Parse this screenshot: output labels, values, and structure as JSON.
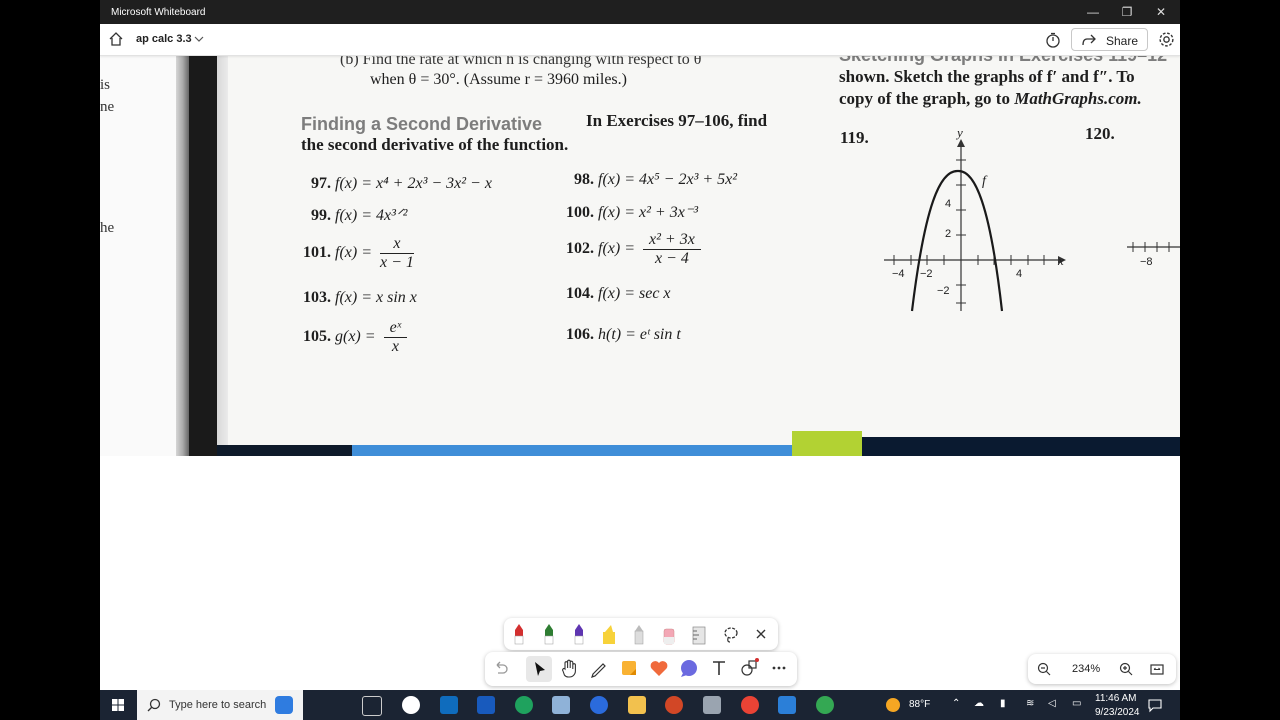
{
  "window": {
    "title": "Microsoft Whiteboard"
  },
  "header": {
    "board_name": "ap calc 3.3",
    "share_label": "Share"
  },
  "left_page_fragments": [
    "is",
    "ne",
    "he"
  ],
  "textbook": {
    "part_b_line1": "(b) Find the rate at which h is changing with respect to θ",
    "part_b_line2": "when θ = 30°. (Assume r = 3960 miles.)",
    "section_heading": "Finding a Second Derivative",
    "section_intro": "In Exercises 97–106, find",
    "section_intro2": "the second derivative of the function.",
    "ex97_num": "97.",
    "ex97": "f(x) = x⁴ + 2x³ − 3x² − x",
    "ex98_num": "98.",
    "ex98": "f(x) = 4x⁵ − 2x³ + 5x²",
    "ex99_num": "99.",
    "ex99": "f(x) = 4x³ᐟ²",
    "ex100_num": "100.",
    "ex100": "f(x) = x² + 3x⁻³",
    "ex101_num": "101.",
    "ex101_lhs": "f(x) =",
    "ex101_num_top": "x",
    "ex101_den": "x − 1",
    "ex102_num": "102.",
    "ex102_lhs": "f(x) =",
    "ex102_num_top": "x² + 3x",
    "ex102_den": "x − 4",
    "ex103_num": "103.",
    "ex103": "f(x) = x sin x",
    "ex104_num": "104.",
    "ex104": "f(x) = sec x",
    "ex105_num": "105.",
    "ex105_lhs": "g(x) =",
    "ex105_num_top": "eˣ",
    "ex105_den": "x",
    "ex106_num": "106.",
    "ex106": "h(t) = eᵗ sin t",
    "right_heading_partial": "Sketching Graphs   In Exercises 119–12",
    "right_line1": "shown. Sketch the graphs of f′ and f″. To",
    "right_line2_a": "copy of the graph, go to ",
    "right_line2_b": "MathGraphs.com.",
    "ex119_num": "119.",
    "ex120_num": "120.",
    "graph": {
      "x_axis_label": "x",
      "y_axis_label": "y",
      "curve_label": "f",
      "tick_labels": [
        "−4",
        "−2",
        "4",
        "4",
        "2",
        "−2"
      ],
      "partial_tick": "−8"
    }
  },
  "toolbar": {
    "pens": [
      "red-pen",
      "green-pen",
      "purple-pen",
      "yellow-highlighter",
      "pencil",
      "eraser",
      "ruler"
    ],
    "colors": {
      "red": "#d32f2f",
      "green": "#2e7d32",
      "purple": "#5e35b1",
      "yellow": "#f7d23a"
    }
  },
  "zoom": {
    "level": "234%"
  },
  "taskbar": {
    "search_placeholder": "Type here to search",
    "temperature": "88°F",
    "time": "11:46 AM",
    "date": "9/23/2024"
  }
}
